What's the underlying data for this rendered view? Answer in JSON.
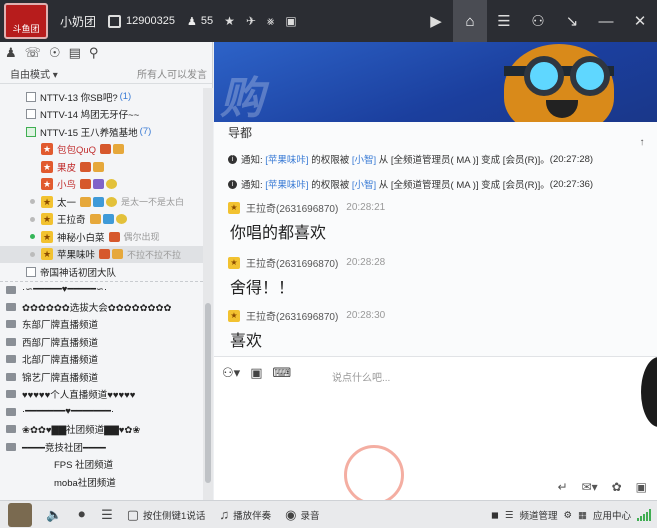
{
  "app": {
    "username": "小奶团",
    "user_id": "12900325",
    "online_count": "55",
    "logo_text": "斗鱼团",
    "colors": {
      "topbar": "#2b2d33",
      "accent": "#3a7bd5",
      "banner": "#2d63c8",
      "ok": "#3fae52"
    }
  },
  "top_icons": [
    "person-icon",
    "star-icon",
    "plane-icon",
    "share-icon",
    "screen-icon"
  ],
  "top_right": [
    "video-icon",
    "home-icon",
    "list-icon",
    "gamepad-icon",
    "download-icon",
    "minimize-icon",
    "close-icon"
  ],
  "left": {
    "mode": "自由模式",
    "permission": "所有人可以发言",
    "tree": [
      {
        "kind": "channel",
        "name": "NTTV-13 你SB吧?",
        "count": "(1)"
      },
      {
        "kind": "channel",
        "name": "NTTV-14 鸠团无牙仔~~",
        "count": ""
      },
      {
        "kind": "channel",
        "name": "NTTV-15 王八养殖基地",
        "count": "(7)",
        "green": true
      },
      {
        "kind": "user",
        "name": "包包QuQ",
        "red": true
      },
      {
        "kind": "user",
        "name": "果皮",
        "red": true
      },
      {
        "kind": "user",
        "name": "小鸟",
        "red": true
      },
      {
        "kind": "user",
        "name": "太一",
        "sig": "是太一不是太白"
      },
      {
        "kind": "user",
        "name": "王拉奇"
      },
      {
        "kind": "user",
        "name": "神秘小白菜",
        "sig": "偶尔出现",
        "online": true
      },
      {
        "kind": "user",
        "name": "苹果味咔",
        "sig": "不拉不拉不拉",
        "selected": true
      },
      {
        "kind": "channel",
        "name": "帝国神话初团大队",
        "count": ""
      },
      {
        "kind": "group",
        "name": "·∽━━━━━♥━━━━━∽·"
      },
      {
        "kind": "group",
        "name": "✿✿✿✿✿✿选拔大会✿✿✿✿✿✿✿✿"
      },
      {
        "kind": "group",
        "name": "东部厂牌直播频道"
      },
      {
        "kind": "group",
        "name": "西部厂牌直播频道"
      },
      {
        "kind": "group",
        "name": "北部厂牌直播频道"
      },
      {
        "kind": "group",
        "name": "锦艺厂牌直播频道"
      },
      {
        "kind": "group",
        "name": "♥♥♥♥♥个人直播频道♥♥♥♥♥"
      },
      {
        "kind": "group",
        "name": "·━━━━━━━♥━━━━━━━·"
      },
      {
        "kind": "group",
        "name": "❀✿✿♥▇▇社团频道▇▇♥✿❀"
      },
      {
        "kind": "group",
        "name": "━━━━竞技社团━━━━"
      },
      {
        "kind": "sub",
        "name": "FPS 社团频道"
      },
      {
        "kind": "sub",
        "name": "moba社团频道"
      }
    ]
  },
  "banner": {
    "bg_text": "购"
  },
  "chat": {
    "title": "导都",
    "notices": [
      {
        "text_pre": "通知:",
        "who": "[苹果味咔]",
        "mid": "的权限被",
        "by": "[小智]",
        "rest": "从 [全频道管理员( MA )] 变成 [会员(R)]。",
        "time": "(20:27:28)"
      },
      {
        "text_pre": "通知:",
        "who": "[苹果味咔]",
        "mid": "的权限被",
        "by": "[小智]",
        "rest": "从 [全频道管理员( MA )] 变成 [会员(R)]。",
        "time": "(20:27:36)"
      }
    ],
    "messages": [
      {
        "sender": "王拉奇(2631696870)",
        "time": "20:28:21",
        "text": "你唱的都喜欢"
      },
      {
        "sender": "王拉奇(2631696870)",
        "time": "20:28:28",
        "text": "舍得！！"
      },
      {
        "sender": "王拉奇(2631696870)",
        "time": "20:28:30",
        "text": "喜欢"
      }
    ],
    "input_placeholder": "说点什么吧..."
  },
  "bottom": {
    "ptt": "按住侧键1说话",
    "accompany": "播放伴奏",
    "record": "录音",
    "channel_manage": "频道管理",
    "app_center": "应用中心"
  }
}
